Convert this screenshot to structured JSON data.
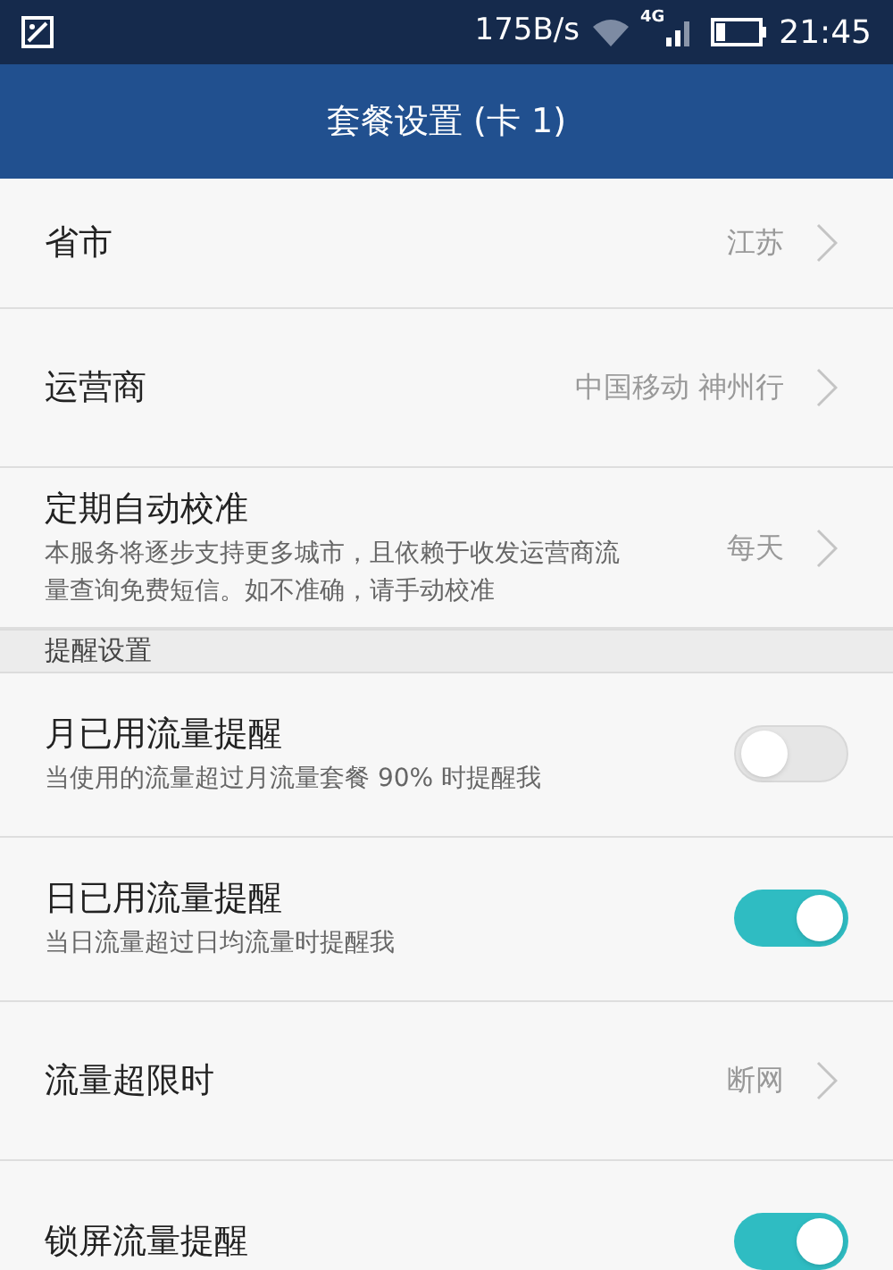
{
  "status_bar": {
    "speed": "175B/s",
    "network": "4G",
    "time": "21:45"
  },
  "header": {
    "title": "套餐设置 (卡 1)"
  },
  "items": [
    {
      "kind": "nav",
      "title": "省市",
      "value": "江苏"
    },
    {
      "kind": "nav",
      "title": "运营商",
      "value": "中国移动 神州行"
    },
    {
      "kind": "nav",
      "title": "定期自动校准",
      "subtitle": "本服务将逐步支持更多城市，且依赖于收发运营商流量查询免费短信。如不准确，请手动校准",
      "value": "每天"
    },
    {
      "kind": "header",
      "title": "提醒设置"
    },
    {
      "kind": "toggle",
      "title": "月已用流量提醒",
      "subtitle": "当使用的流量超过月流量套餐 90% 时提醒我",
      "on": false
    },
    {
      "kind": "toggle",
      "title": "日已用流量提醒",
      "subtitle": "当日流量超过日均流量时提醒我",
      "on": true
    },
    {
      "kind": "nav",
      "title": "流量超限时",
      "value": "断网"
    },
    {
      "kind": "toggle",
      "title": "锁屏流量提醒",
      "on": true
    }
  ]
}
